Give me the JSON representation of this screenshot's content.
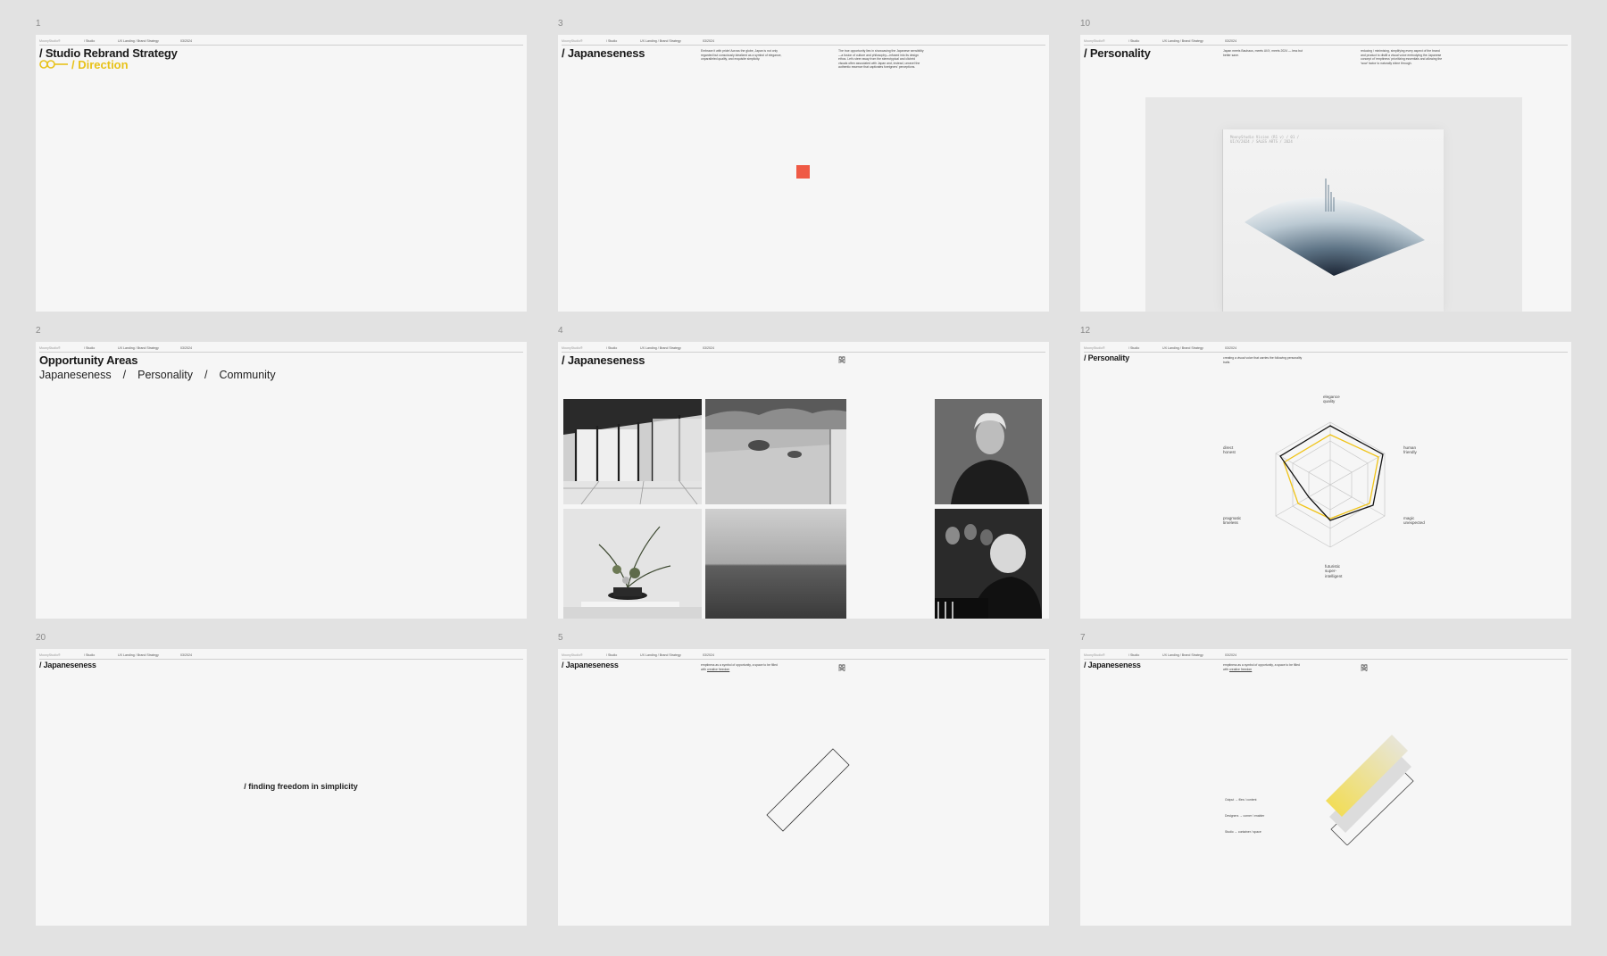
{
  "slides": [
    {
      "number": "1",
      "meta": [
        "MoonyStudio®",
        "/ Studio",
        "UX Landing / Brand Strategy",
        "03/2024"
      ],
      "title": "/ Studio Rebrand Strategy",
      "subtitle": "/ Direction",
      "accent_color": "#e8c21a"
    },
    {
      "number": "3",
      "meta": [
        "MoonyStudio®",
        "/ Studio",
        "UX Landing / Brand Strategy",
        "03/2024"
      ],
      "title": "/ Japaneseness",
      "text_a": "Embrace it with pride! Across the globe, Japan is not only regarded but consciously idealized as a symbol of elegance, unparalleled quality, and exquisite simplicity.",
      "text_b": "The true opportunity lies in showcasing the Japanese sensibility—a fusion of culture and philosophy—infused into its design ethos. Let's steer away from the stereotypical and clichéd visuals often associated with Japan and, instead, unravel the authentic essence that captivates foreigners' perceptions.",
      "square_color": "#ef5a45"
    },
    {
      "number": "10",
      "meta": [
        "MoonyStudio®",
        "/ Studio",
        "UX Landing / Brand Strategy",
        "03/2024"
      ],
      "title": "/ Personality",
      "text_a": "Japan meets Bauhaus, meets UI/X, meets 2024 — less but better sane.",
      "text_b": "reducing / minimising, simplifying every aspect of the brand and product to distill a visual voice embodying the Japanese concept of 'emptiness' prioritizing essentials and allowing the 'wow' factor to naturally shine through.",
      "mock_text": "MoonyStudio Vision (R1 v) / 01 / UI/X/2024 / SALES ARTS / 2024"
    },
    {
      "number": "2",
      "meta": [
        "MoonyStudio®",
        "/ Studio",
        "UX Landing / Brand Strategy",
        "03/2024"
      ],
      "title": "Opportunity Areas",
      "areas": [
        "Japaneseness",
        "/",
        "Personality",
        "/",
        "Community"
      ]
    },
    {
      "number": "4",
      "meta": [
        "MoonyStudio®",
        "/ Studio",
        "UX Landing / Brand Strategy",
        "03/2024"
      ],
      "title": "/ Japaneseness",
      "kanji": "間"
    },
    {
      "number": "12",
      "meta": [
        "MoonyStudio®",
        "/ Studio",
        "UX Landing / Brand Strategy",
        "03/2024"
      ],
      "title": "/ Personality",
      "text_a": "creating a visual voice that carries the following personality traits",
      "radar_labels": {
        "top": "elegance\nquality",
        "right_top": "human\nfriendly",
        "right_bottom": "magic\nunexpected",
        "bottom": "futuristic\nsuper-\nintelligent",
        "left_bottom": "pragmatic\ntimeless",
        "left_top": "direct\nhonest"
      },
      "radar_colors": {
        "series_a": "#111111",
        "series_b": "#f0c419"
      }
    },
    {
      "number": "20",
      "meta": [
        "MoonyStudio®",
        "/ Studio",
        "UX Landing / Brand Strategy",
        "03/2024"
      ],
      "title": "/ Japaneseness",
      "center_text": "/ finding freedom in simplicity"
    },
    {
      "number": "5",
      "meta": [
        "MoonyStudio®",
        "/ Studio",
        "UX Landing / Brand Strategy",
        "03/2024"
      ],
      "title": "/ Japaneseness",
      "text_a": "emptiness as a symbol of opportunity, a space to be filled with",
      "text_link": "creative freedom",
      "kanji": "間"
    },
    {
      "number": "7",
      "meta": [
        "MoonyStudio®",
        "/ Studio",
        "UX Landing / Brand Strategy",
        "03/2024"
      ],
      "title": "/ Japaneseness",
      "text_a": "emptiness as a symbol of opportunity, a space to be filled with",
      "text_link": "creative freedom",
      "kanji": "間",
      "layers": [
        "Output → files / content",
        "Designers → corner / enabler",
        "Studio → container / space"
      ],
      "layer_color": "#f3dc4a"
    }
  ]
}
